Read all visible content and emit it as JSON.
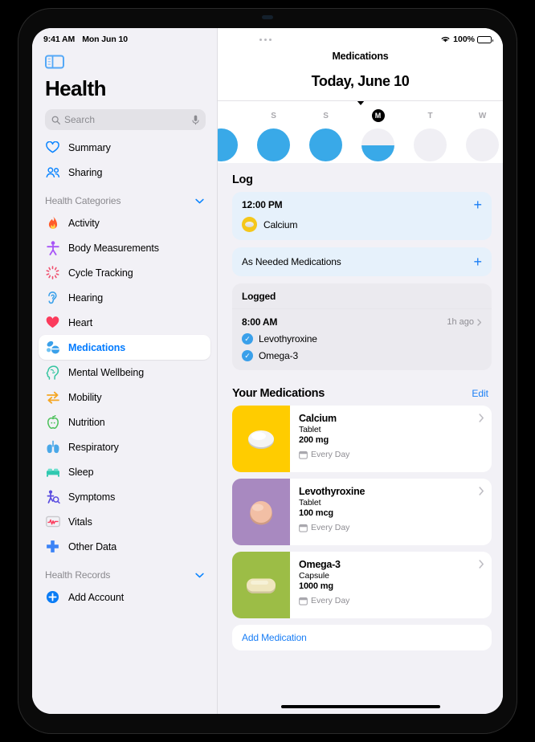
{
  "status_bar": {
    "time": "9:41 AM",
    "date": "Mon Jun 10",
    "battery_percent": "100%",
    "wifi_icon": "wifi-icon",
    "battery_icon": "battery-icon",
    "more_icon": "more-dots-icon"
  },
  "sidebar": {
    "toggle_icon": "sidebar-toggle-icon",
    "title": "Health",
    "search": {
      "placeholder": "Search",
      "icon": "search-icon",
      "mic_icon": "microphone-icon"
    },
    "top_items": [
      {
        "label": "Summary",
        "icon": "heart-outline-icon"
      },
      {
        "label": "Sharing",
        "icon": "people-icon"
      }
    ],
    "categories_header": {
      "label": "Health Categories",
      "chevron": "chevron-down-icon"
    },
    "categories": [
      {
        "label": "Activity",
        "icon": "flame-icon"
      },
      {
        "label": "Body Measurements",
        "icon": "body-icon"
      },
      {
        "label": "Cycle Tracking",
        "icon": "cycle-icon"
      },
      {
        "label": "Hearing",
        "icon": "ear-icon"
      },
      {
        "label": "Heart",
        "icon": "heart-filled-icon"
      },
      {
        "label": "Medications",
        "icon": "pills-icon"
      },
      {
        "label": "Mental Wellbeing",
        "icon": "brain-head-icon"
      },
      {
        "label": "Mobility",
        "icon": "mobility-arrows-icon"
      },
      {
        "label": "Nutrition",
        "icon": "apple-icon"
      },
      {
        "label": "Respiratory",
        "icon": "lungs-icon"
      },
      {
        "label": "Sleep",
        "icon": "bed-icon"
      },
      {
        "label": "Symptoms",
        "icon": "symptoms-icon"
      },
      {
        "label": "Vitals",
        "icon": "vitals-waveform-icon"
      },
      {
        "label": "Other Data",
        "icon": "plus-cross-icon"
      }
    ],
    "selected_item": "Medications",
    "records_header": {
      "label": "Health Records",
      "chevron": "chevron-down-icon"
    },
    "add_account": {
      "label": "Add Account",
      "icon": "plus-circle-icon"
    }
  },
  "main": {
    "nav_title": "Medications",
    "today_title": "Today, June 10",
    "day_strip": [
      {
        "label": "",
        "state": "full"
      },
      {
        "label": "S",
        "state": "full"
      },
      {
        "label": "S",
        "state": "full"
      },
      {
        "label": "M",
        "state": "half",
        "today": true
      },
      {
        "label": "T",
        "state": "empty"
      },
      {
        "label": "W",
        "state": "empty"
      },
      {
        "label": "",
        "state": "empty"
      }
    ],
    "log": {
      "title": "Log",
      "scheduled": {
        "time": "12:00 PM",
        "add_icon": "plus-icon",
        "medication": "Calcium",
        "pill_icon": "calcium-pill-icon"
      },
      "as_needed": {
        "label": "As Needed Medications",
        "add_icon": "plus-icon"
      }
    },
    "logged": {
      "title": "Logged",
      "time": "8:00 AM",
      "relative": "1h ago",
      "chevron": "chevron-right-icon",
      "items": [
        {
          "name": "Levothyroxine",
          "check_icon": "checkmark-circle-icon"
        },
        {
          "name": "Omega-3",
          "check_icon": "checkmark-circle-icon"
        }
      ]
    },
    "your_medications": {
      "title": "Your Medications",
      "edit_label": "Edit",
      "items": [
        {
          "name": "Calcium",
          "form": "Tablet",
          "dose": "200 mg",
          "frequency": "Every Day",
          "calendar_icon": "calendar-icon",
          "chevron": "chevron-right-icon",
          "bg_color": "#FFCC00",
          "pill_shape": "oval",
          "pill_color": "#F0F0F0"
        },
        {
          "name": "Levothyroxine",
          "form": "Tablet",
          "dose": "100 mcg",
          "frequency": "Every Day",
          "calendar_icon": "calendar-icon",
          "chevron": "chevron-right-icon",
          "bg_color": "#A889C0",
          "pill_shape": "round",
          "pill_color": "#F2BFA5"
        },
        {
          "name": "Omega-3",
          "form": "Capsule",
          "dose": "1000 mg",
          "frequency": "Every Day",
          "calendar_icon": "calendar-icon",
          "chevron": "chevron-right-icon",
          "bg_color": "#9CBD46",
          "pill_shape": "capsule",
          "pill_color": "#EFE6BE"
        }
      ],
      "add_label": "Add Medication"
    }
  },
  "colors": {
    "accent_blue": "#007aff",
    "link_blue": "#1a7ef5",
    "day_fill": "#39a9e8",
    "sidebar_bg": "#f2f1f6",
    "tinted_card": "#e6f1fb"
  }
}
